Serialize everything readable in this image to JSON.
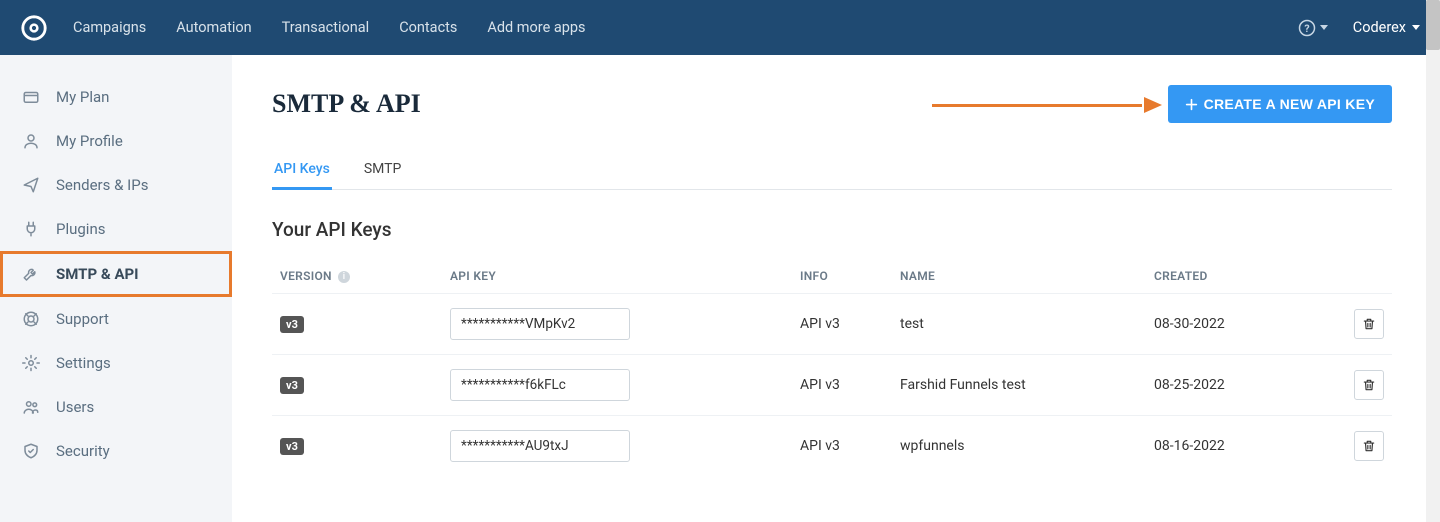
{
  "topnav": {
    "items": [
      "Campaigns",
      "Automation",
      "Transactional",
      "Contacts",
      "Add more apps"
    ],
    "account": "Coderex"
  },
  "sidebar": {
    "items": [
      {
        "label": "My Plan",
        "icon": "plan"
      },
      {
        "label": "My Profile",
        "icon": "profile"
      },
      {
        "label": "Senders & IPs",
        "icon": "send"
      },
      {
        "label": "Plugins",
        "icon": "plug"
      },
      {
        "label": "SMTP & API",
        "icon": "wrench",
        "active": true
      },
      {
        "label": "Support",
        "icon": "support"
      },
      {
        "label": "Settings",
        "icon": "gear"
      },
      {
        "label": "Users",
        "icon": "users"
      },
      {
        "label": "Security",
        "icon": "shield"
      }
    ]
  },
  "page": {
    "title": "SMTP & API",
    "create_button": "CREATE A NEW API KEY"
  },
  "tabs": [
    {
      "label": "API Keys",
      "active": true
    },
    {
      "label": "SMTP",
      "active": false
    }
  ],
  "section_title": "Your API Keys",
  "table": {
    "headers": {
      "version": "VERSION",
      "api_key": "API KEY",
      "info": "INFO",
      "name": "NAME",
      "created": "CREATED"
    },
    "rows": [
      {
        "version": "v3",
        "key": "***********VMpKv2",
        "info": "API v3",
        "name": "test",
        "created": "08-30-2022"
      },
      {
        "version": "v3",
        "key": "***********f6kFLc",
        "info": "API v3",
        "name": "Farshid Funnels test",
        "created": "08-25-2022"
      },
      {
        "version": "v3",
        "key": "***********AU9txJ",
        "info": "API v3",
        "name": "wpfunnels",
        "created": "08-16-2022"
      }
    ]
  }
}
